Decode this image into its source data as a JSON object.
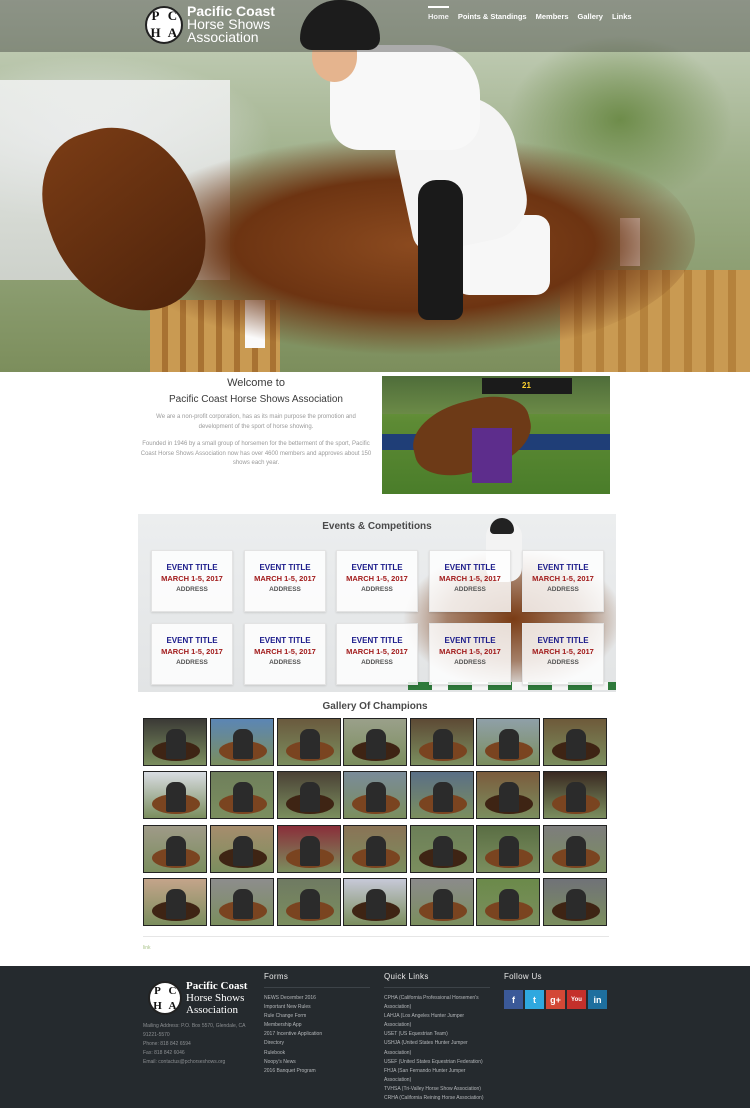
{
  "site": {
    "logo_seal": [
      "P",
      "C",
      "H",
      "A"
    ],
    "logo_lines": [
      "Pacific Coast",
      "Horse Shows",
      "Association"
    ]
  },
  "nav": {
    "items": [
      "Home",
      "Points & Standings",
      "Members",
      "Gallery",
      "Links"
    ],
    "active": "Home"
  },
  "welcome": {
    "heading": "Welcome to",
    "subheading": "Pacific Coast Horse Shows Association",
    "para1": "We are a non-profit corporation, has as its main purpose the promotion and development of the sport of horse showing.",
    "para2": "Founded in 1946 by a small group of horsemen for the betterment of the sport, Pacific Coast Horse Shows Association now has over 4600 members and approves about 150 shows each year.",
    "photo_board": "21"
  },
  "events": {
    "title": "Events & Competitions",
    "cards": [
      {
        "title": "EVENT TITLE",
        "date": "MARCH 1-5, 2017",
        "address": "ADDRESS"
      },
      {
        "title": "EVENT TITLE",
        "date": "MARCH 1-5, 2017",
        "address": "ADDRESS"
      },
      {
        "title": "EVENT TITLE",
        "date": "MARCH 1-5, 2017",
        "address": "ADDRESS"
      },
      {
        "title": "EVENT TITLE",
        "date": "MARCH 1-5, 2017",
        "address": "ADDRESS"
      },
      {
        "title": "EVENT TITLE",
        "date": "MARCH 1-5, 2017",
        "address": "ADDRESS"
      },
      {
        "title": "EVENT TITLE",
        "date": "MARCH 1-5, 2017",
        "address": "ADDRESS"
      },
      {
        "title": "EVENT TITLE",
        "date": "MARCH 1-5, 2017",
        "address": "ADDRESS"
      },
      {
        "title": "EVENT TITLE",
        "date": "MARCH 1-5, 2017",
        "address": "ADDRESS"
      },
      {
        "title": "EVENT TITLE",
        "date": "MARCH 1-5, 2017",
        "address": "ADDRESS"
      },
      {
        "title": "EVENT TITLE",
        "date": "MARCH 1-5, 2017",
        "address": "ADDRESS"
      }
    ]
  },
  "gallery": {
    "title": "Gallery Of Champions",
    "tones": [
      [
        "#3b3a36",
        "#5b86b5",
        "#6a5a3e",
        "#9aa08a",
        "#5d4a35",
        "#8fa0a8",
        "#6e5a3a"
      ],
      [
        "#d8dce2",
        "#6f7f5c",
        "#4b4236",
        "#7a8b99",
        "#5a6f86",
        "#7b5c3d",
        "#3a2a22"
      ],
      [
        "#9f9a88",
        "#a68d6d",
        "#8a2f3a",
        "#8a7356",
        "#6c7f58",
        "#5a6e44",
        "#7d7d7d"
      ],
      [
        "#c4a48a",
        "#8d8d8d",
        "#6f7a62",
        "#c7c9d8",
        "#8b8b8b",
        "#6b8a4a",
        "#707278"
      ]
    ]
  },
  "misc": {
    "tiny_link": "link"
  },
  "footer": {
    "contact": [
      "Mailing Address: P.O. Box 5570, Glendale, CA 91221-5570",
      "Phone: 818 842 6594",
      "Fax: 818 842 6046",
      "Email: contactus@pchorseshows.org"
    ],
    "forms_title": "Forms",
    "forms": [
      "NEWS December 2016",
      "Important New Rules",
      "Rule Change Form",
      "Membership App",
      "2017 Incentive Application",
      "Directory",
      "Rulebook",
      "Noopy's News",
      "2016 Banquet Program"
    ],
    "quick_title": "Quick Links",
    "quick": [
      "CPHA (California Professional Horsemen's Association)",
      "LAHJA (Los Angeles Hunter Jumper Association)",
      "USET (US Equestrian Team)",
      "USHJA (United States Hunter Jumper Association)",
      "USEF (United States Equestrian Federation)",
      "FHJA (San Fernando Hunter Jumper Association)",
      "TVHSA (Tri-Valley Horse Show Association)",
      "CRHA (California Reining Horse Association)"
    ],
    "follow_title": "Follow Us",
    "social": [
      {
        "icon": "facebook-icon",
        "glyph": "f",
        "color": "#3b5998"
      },
      {
        "icon": "twitter-icon",
        "glyph": "t",
        "color": "#2fa8df"
      },
      {
        "icon": "google-plus-icon",
        "glyph": "g+",
        "color": "#d34836"
      },
      {
        "icon": "youtube-icon",
        "glyph": "You",
        "color": "#c4302b"
      },
      {
        "icon": "linkedin-icon",
        "glyph": "in",
        "color": "#1e6f9e"
      }
    ]
  }
}
